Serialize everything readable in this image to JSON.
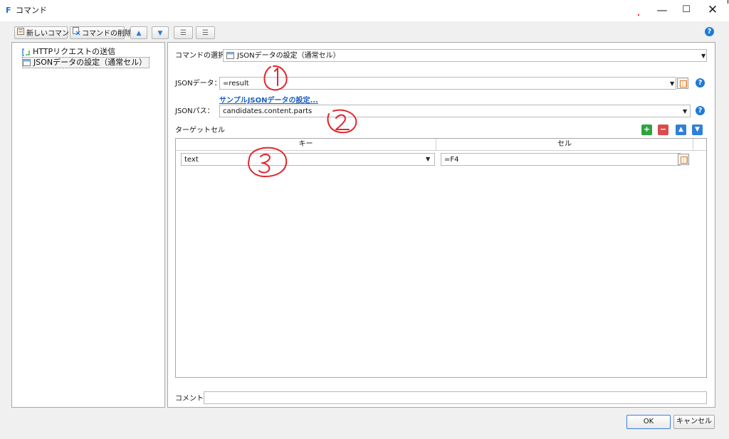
{
  "window": {
    "title": "コマンド",
    "app_icon_glyph": "F",
    "minimize_glyph": "—",
    "maximize_glyph": "☐",
    "close_glyph": "✕"
  },
  "toolbar": {
    "new_command_label": "新しいコマンド",
    "delete_command_label": "コマンドの削除",
    "move_up_glyph": "▲",
    "move_down_glyph": "▼",
    "indent_glyph": "☰",
    "outdent_glyph": "☰",
    "help_glyph": "?"
  },
  "tree": {
    "items": [
      {
        "label": "HTTPリクエストの送信",
        "icon": "http-request-icon"
      },
      {
        "label": "JSONデータの設定（通常セル）",
        "icon": "json-data-icon"
      }
    ]
  },
  "form": {
    "command_select_label": "コマンドの選択：",
    "command_select_value": "JSONデータの設定（通常セル）",
    "json_data_label": "JSONデータ：",
    "json_data_value": "=result",
    "sample_link": "サンプルJSONデータの設定...",
    "json_path_label": "JSONパス：",
    "json_path_value": "candidates.content.parts",
    "target_cell_label": "ターゲットセル",
    "help_glyph": "?"
  },
  "row_buttons": {
    "add": "+",
    "remove": "−",
    "up": "▲",
    "down": "▼"
  },
  "grid": {
    "columns": [
      "キー",
      "セル"
    ],
    "rows": [
      {
        "key": "text",
        "cell": "=F4"
      }
    ]
  },
  "comment": {
    "label": "コメント",
    "value": ""
  },
  "footer": {
    "ok_label": "OK",
    "cancel_label": "キャンセル"
  },
  "colors": {
    "accent_blue": "#1d7ad7",
    "add_green": "#2fa33f",
    "remove_red": "#dc4b4b",
    "annotation_red": "#e2262c"
  }
}
